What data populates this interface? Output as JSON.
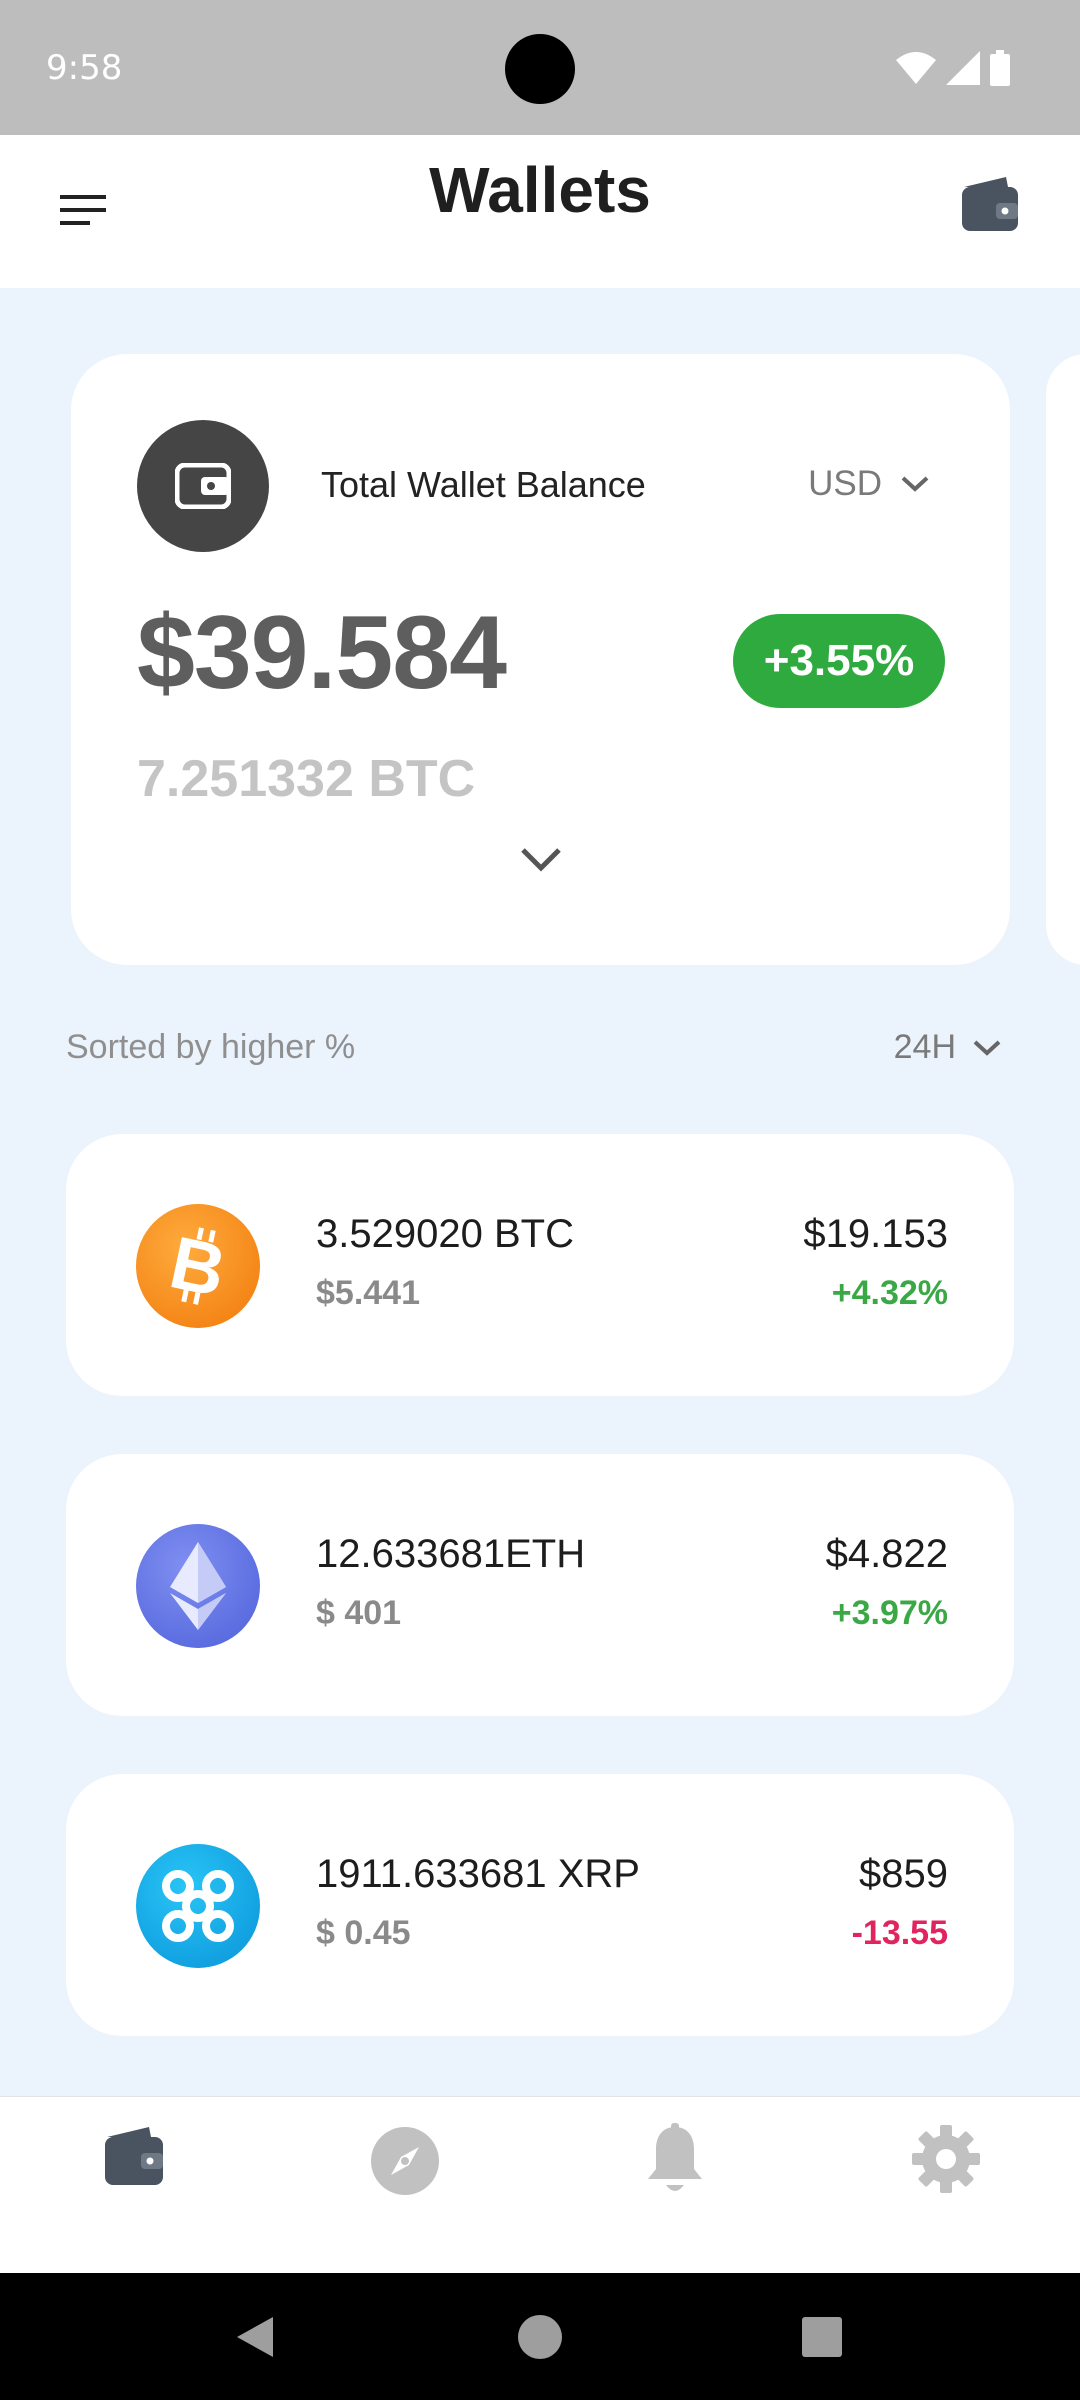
{
  "status_bar": {
    "time": "9:58"
  },
  "app_bar": {
    "title": "Wallets",
    "menu_icon": "menu-icon",
    "action_icon": "wallet-icon"
  },
  "balance_card": {
    "label": "Total Wallet Balance",
    "currency": "USD",
    "amount": "$39.584",
    "change": "+3.55%",
    "btc": "7.251332 BTC",
    "colors": {
      "change_bg": "#2eaa3e"
    }
  },
  "sort": {
    "label": "Sorted by higher %",
    "period": "24H"
  },
  "coins": [
    {
      "amount": "3.529020 BTC",
      "price": "$5.441",
      "value": "$19.153",
      "change": "+4.32%",
      "change_color": "#3aa845",
      "logo": "bitcoin-logo"
    },
    {
      "amount": "12.633681ETH",
      "price": "$ 401",
      "value": "$4.822",
      "change": "+3.97%",
      "change_color": "#3aa845",
      "logo": "ethereum-logo"
    },
    {
      "amount": "1911.633681 XRP",
      "price": "$ 0.45",
      "value": "$859",
      "change": "-13.55",
      "change_color": "#e0245e",
      "logo": "xrp-logo"
    }
  ],
  "bottom_nav": [
    {
      "icon": "wallet-icon",
      "active": true
    },
    {
      "icon": "compass-icon",
      "active": false
    },
    {
      "icon": "bell-icon",
      "active": false
    },
    {
      "icon": "gear-icon",
      "active": false
    }
  ]
}
